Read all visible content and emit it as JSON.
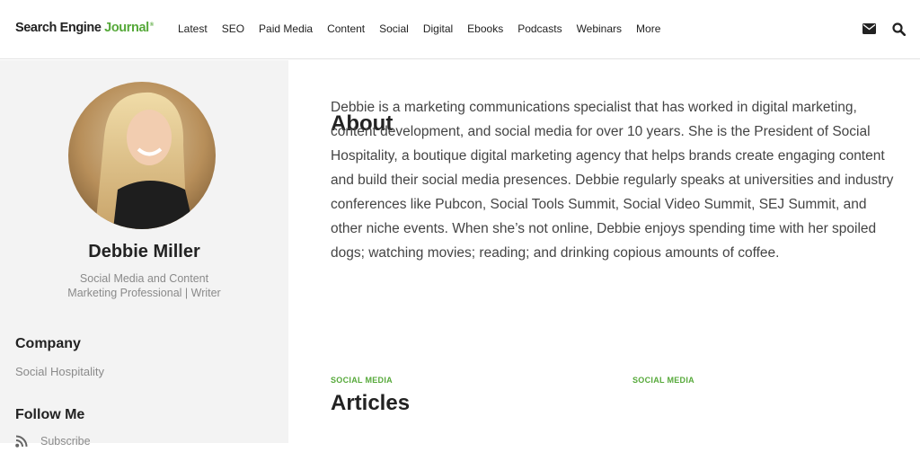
{
  "header": {
    "logo_main": "Search Engine ",
    "logo_accent": "Journal",
    "logo_tm": "®",
    "nav": [
      "Latest",
      "SEO",
      "Paid Media",
      "Content",
      "Social",
      "Digital",
      "Ebooks",
      "Podcasts",
      "Webinars",
      "More"
    ]
  },
  "sidebar": {
    "name": "Debbie Miller",
    "title": "Social Media and Content Marketing Professional | Writer",
    "company_heading": "Company",
    "company": "Social Hospitality",
    "follow_heading": "Follow Me",
    "subscribe": "Subscribe"
  },
  "main": {
    "about_heading": "About",
    "about_text": "Debbie is a marketing communications specialist that has worked in digital marketing, content development, and social media for over 10 years. She is the President of Social Hospitality, a boutique digital marketing agency that helps brands create engaging content and build their social media presences. Debbie regularly speaks at universities and industry conferences like Pubcon, Social Tools Summit, Social Video Summit, SEJ Summit, and other niche events. When she’s not online, Debbie enjoys spending time with her spoiled dogs; watching movies; reading; and drinking copious amounts of coffee.",
    "articles_heading": "Articles",
    "article_categories": [
      "SOCIAL MEDIA",
      "SOCIAL MEDIA"
    ]
  },
  "colors": {
    "accent": "#56a93a",
    "sidebar_bg": "#f3f3f3"
  }
}
